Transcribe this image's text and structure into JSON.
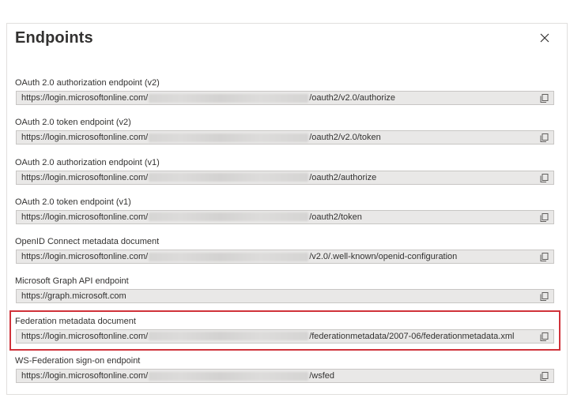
{
  "panel": {
    "title": "Endpoints"
  },
  "icons": {
    "close": "close-icon",
    "copy": "copy-icon"
  },
  "colors": {
    "highlight": "#d0323a",
    "field_bg": "#e9e8e7"
  },
  "endpoints": [
    {
      "label": "OAuth 2.0 authorization endpoint (v2)",
      "prefix": "https://login.microsoftonline.com/",
      "suffix": "/oauth2/v2.0/authorize",
      "redacted": true
    },
    {
      "label": "OAuth 2.0 token endpoint (v2)",
      "prefix": "https://login.microsoftonline.com/",
      "suffix": "/oauth2/v2.0/token",
      "redacted": true
    },
    {
      "label": "OAuth 2.0 authorization endpoint (v1)",
      "prefix": "https://login.microsoftonline.com/",
      "suffix": "/oauth2/authorize",
      "redacted": true
    },
    {
      "label": "OAuth 2.0 token endpoint (v1)",
      "prefix": "https://login.microsoftonline.com/",
      "suffix": "/oauth2/token",
      "redacted": true
    },
    {
      "label": "OpenID Connect metadata document",
      "prefix": "https://login.microsoftonline.com/",
      "suffix": "/v2.0/.well-known/openid-configuration",
      "redacted": true
    },
    {
      "label": "Microsoft Graph API endpoint",
      "prefix": "https://graph.microsoft.com",
      "suffix": "",
      "redacted": false
    },
    {
      "label": "Federation metadata document",
      "prefix": "https://login.microsoftonline.com/",
      "suffix": "/federationmetadata/2007-06/federationmetadata.xml",
      "redacted": true
    },
    {
      "label": "WS-Federation sign-on endpoint",
      "prefix": "https://login.microsoftonline.com/",
      "suffix": "/wsfed",
      "redacted": true
    }
  ]
}
